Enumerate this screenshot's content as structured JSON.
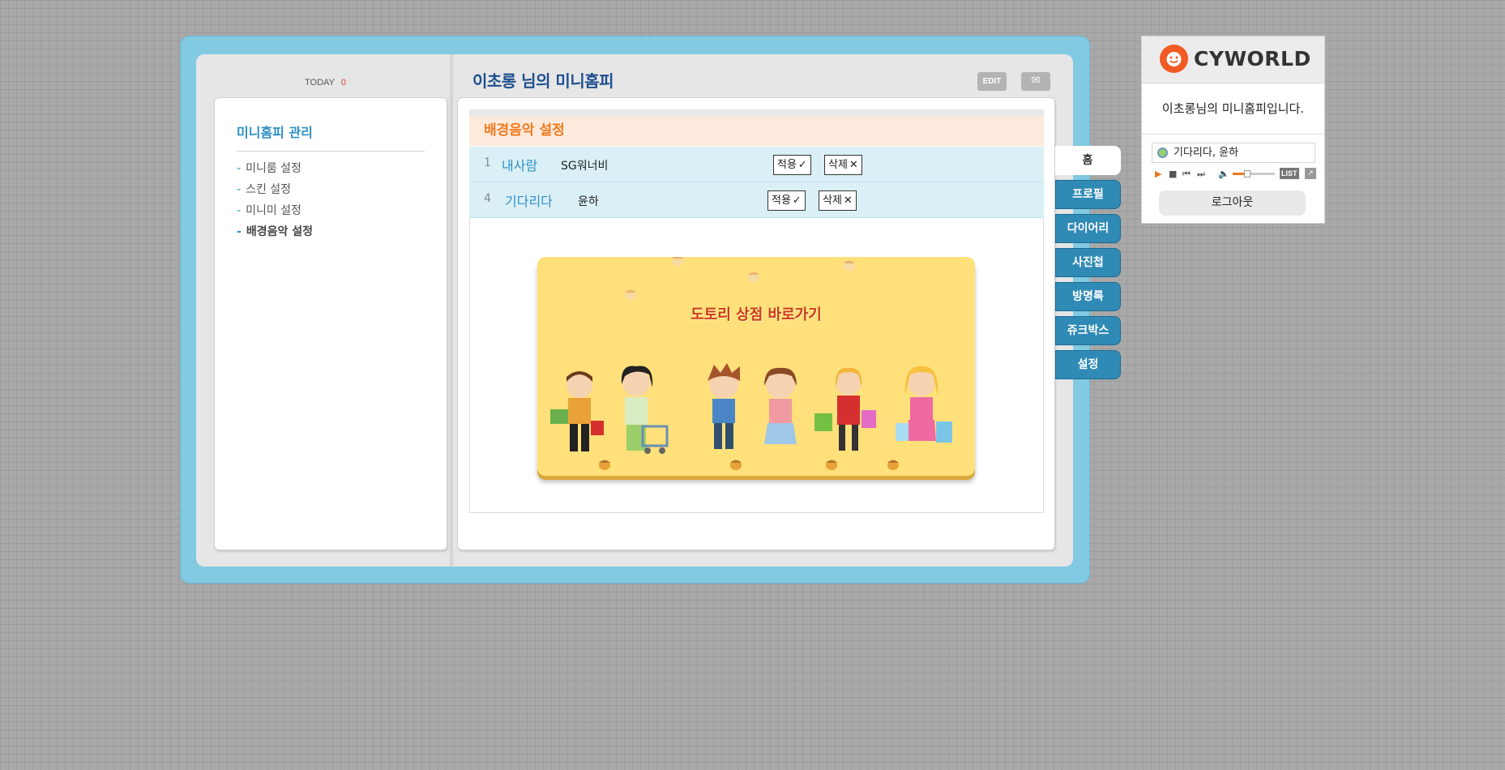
{
  "header": {
    "today_label": "TODAY",
    "today_count": "0",
    "title": "이초롱 님의 미니홈피",
    "edit_label": "EDIT",
    "mail_icon": "mail-icon"
  },
  "sidebar": {
    "title": "미니홈피 관리",
    "items": [
      {
        "label": "미니룸 설정"
      },
      {
        "label": "스킨 설정"
      },
      {
        "label": "미니미 설정"
      },
      {
        "label": "배경음악 설정"
      }
    ],
    "active_index": 3
  },
  "bgm": {
    "title": "배경음악 설정",
    "songs": [
      {
        "num": "1",
        "title": "내사람",
        "artist": "SG워너비",
        "apply": "적용",
        "delete": "삭제"
      },
      {
        "num": "4",
        "title": "기다리다",
        "artist": "윤하",
        "apply": "적용",
        "delete": "삭제"
      }
    ],
    "banner_text": "도토리 상점 바로가기"
  },
  "tabs": [
    {
      "label": "홈"
    },
    {
      "label": "프로필"
    },
    {
      "label": "다이어리"
    },
    {
      "label": "사진첩"
    },
    {
      "label": "방명록"
    },
    {
      "label": "쥬크박스"
    },
    {
      "label": "설정"
    }
  ],
  "widget": {
    "logo": "CYWORLD",
    "message": "이초롱님의 미니홈피입니다.",
    "now_playing": "기다리다, 윤하",
    "volume_level": 0.35,
    "list_label": "LIST",
    "logout_label": "로그아웃"
  },
  "colors": {
    "frame_blue": "#82c9e2",
    "accent_orange": "#f07a1d",
    "link_blue": "#2e8fc4",
    "tab_blue": "#2f8ab5"
  }
}
